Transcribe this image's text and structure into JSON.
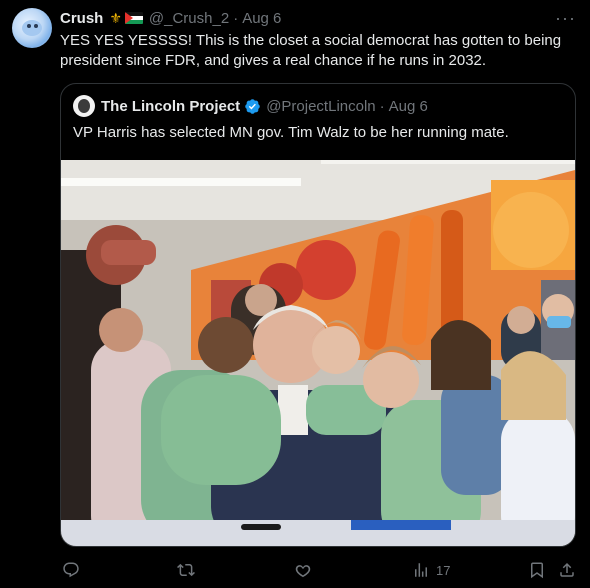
{
  "tweet": {
    "author_name": "Crush",
    "author_handle": "@_Crush_2",
    "separator": "·",
    "date": "Aug 6",
    "more_icon": "more-dots-icon",
    "text": "YES YES YESSSS! This is the closet a social democrat has gotten to being president since FDR, and gives a real chance if he runs in 2032."
  },
  "quote": {
    "author_name": "The Lincoln Project",
    "author_handle": "@ProjectLincoln",
    "separator": "·",
    "date": "Aug 6",
    "text": "VP Harris has selected MN gov. Tim Walz to be her running mate.",
    "verified_color": "#1d9bf0"
  },
  "actions": {
    "reply_icon": "reply-icon",
    "retweet_icon": "retweet-icon",
    "like_icon": "heart-icon",
    "views_icon": "views-chart-icon",
    "views_count": "17",
    "bookmark_icon": "bookmark-icon",
    "share_icon": "share-icon"
  },
  "colors": {
    "background": "#000000",
    "text": "#e7e9ea",
    "muted": "#71767b",
    "border": "#2f3336"
  }
}
